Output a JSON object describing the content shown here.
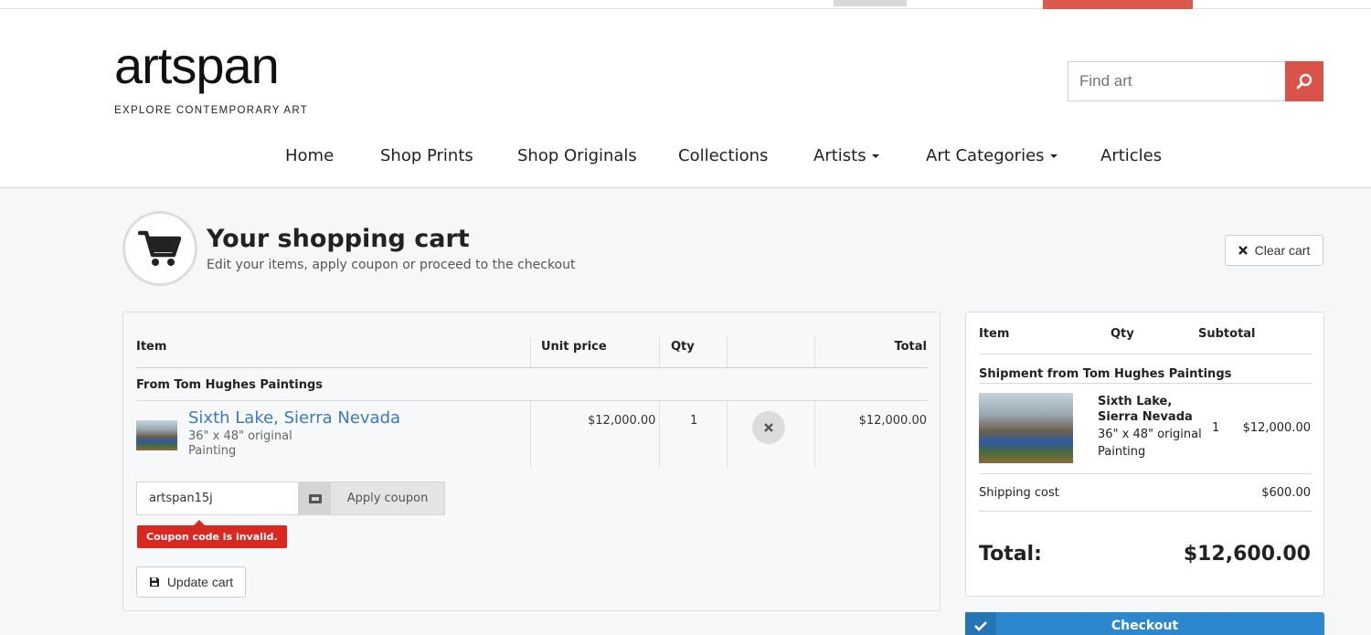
{
  "site": {
    "logo": "artspan",
    "tagline": "EXPLORE CONTEMPORARY ART",
    "search_placeholder": "Find art"
  },
  "nav": {
    "items": [
      "Home",
      "Shop Prints",
      "Shop Originals",
      "Collections",
      "Artists",
      "Art Categories",
      "Articles"
    ]
  },
  "page": {
    "title": "Your shopping cart",
    "subtitle": "Edit your items, apply coupon or proceed to the checkout",
    "clear_label": "Clear cart"
  },
  "cart": {
    "headers": {
      "item": "Item",
      "unit_price": "Unit price",
      "qty": "Qty",
      "total": "Total"
    },
    "group": "From Tom Hughes Paintings",
    "item": {
      "title": "Sixth Lake, Sierra Nevada",
      "size": "36\" x 48\" original",
      "medium": "Painting",
      "unit_price": "$12,000.00",
      "qty": "1",
      "total": "$12,000.00"
    },
    "coupon_value": "artspan15j",
    "apply_label": "Apply coupon",
    "error": "Coupon code is invalid.",
    "update_label": "Update cart"
  },
  "summary": {
    "headers": {
      "item": "Item",
      "qty": "Qty",
      "subtotal": "Subtotal"
    },
    "shipment": "Shipment from Tom Hughes Paintings",
    "item_title_1": "Sixth Lake,",
    "item_title_2": "Sierra Nevada",
    "item_size": "36\" x 48\" original",
    "item_medium": "Painting",
    "item_qty": "1",
    "item_subtotal": "$12,000.00",
    "shipping_label": "Shipping cost",
    "shipping_value": "$600.00",
    "total_label": "Total:",
    "total_value": "$12,600.00",
    "checkout_label": "Checkout"
  },
  "colors": {
    "accent_red": "#d9534a",
    "link_blue": "#3a7bbd",
    "checkout_blue": "#2d87cf",
    "error_red": "#d8281f"
  }
}
